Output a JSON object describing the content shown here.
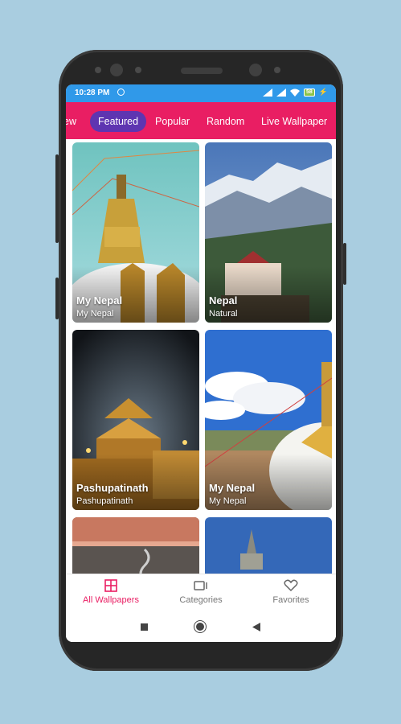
{
  "status_bar": {
    "time": "10:28 PM",
    "battery": "58"
  },
  "tabs": [
    {
      "label": "New"
    },
    {
      "label": "Featured",
      "active": true
    },
    {
      "label": "Popular"
    },
    {
      "label": "Random"
    },
    {
      "label": "Live Wallpaper"
    }
  ],
  "wallpapers": [
    {
      "title": "My Nepal",
      "subtitle": "My Nepal"
    },
    {
      "title": "Nepal",
      "subtitle": "Natural"
    },
    {
      "title": "Pashupatinath",
      "subtitle": "Pashupatinath"
    },
    {
      "title": "My Nepal",
      "subtitle": "My Nepal"
    }
  ],
  "bottom_nav": [
    {
      "label": "All Wallpapers",
      "icon": "grid-icon",
      "active": true
    },
    {
      "label": "Categories",
      "icon": "categories-icon"
    },
    {
      "label": "Favorites",
      "icon": "heart-icon"
    }
  ],
  "colors": {
    "status_bar": "#3099e9",
    "tab_bar": "#e91e63",
    "active_tab": "#5e35b1",
    "nav_active": "#e91e63"
  }
}
